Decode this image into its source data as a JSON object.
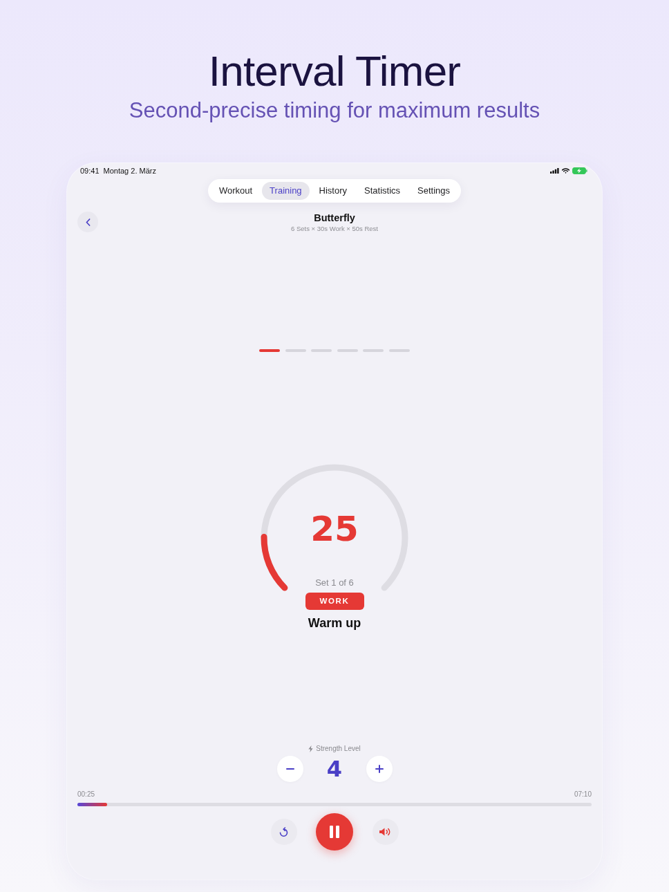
{
  "hero": {
    "title": "Interval Timer",
    "subtitle": "Second-precise timing for maximum results"
  },
  "status_bar": {
    "time": "09:41",
    "date": "Montag 2. März"
  },
  "tabs": [
    {
      "label": "Workout",
      "selected": false
    },
    {
      "label": "Training",
      "selected": true
    },
    {
      "label": "History",
      "selected": false
    },
    {
      "label": "Statistics",
      "selected": false
    },
    {
      "label": "Settings",
      "selected": false
    }
  ],
  "workout": {
    "title": "Butterfly",
    "subtitle": "6 Sets × 30s Work × 50s Rest"
  },
  "set_indicators": [
    {
      "current": true
    },
    {
      "current": false
    },
    {
      "current": false
    },
    {
      "current": false
    },
    {
      "current": false
    },
    {
      "current": false
    }
  ],
  "timer": {
    "remaining": "25",
    "level": 0.17,
    "set_label": "Set 1 of 6",
    "phase": "WORK",
    "exercise": "Warm up"
  },
  "strength": {
    "label": "Strength Level",
    "value": "4"
  },
  "progress": {
    "elapsed": "00:25",
    "total": "07:10",
    "level": 0.058
  }
}
